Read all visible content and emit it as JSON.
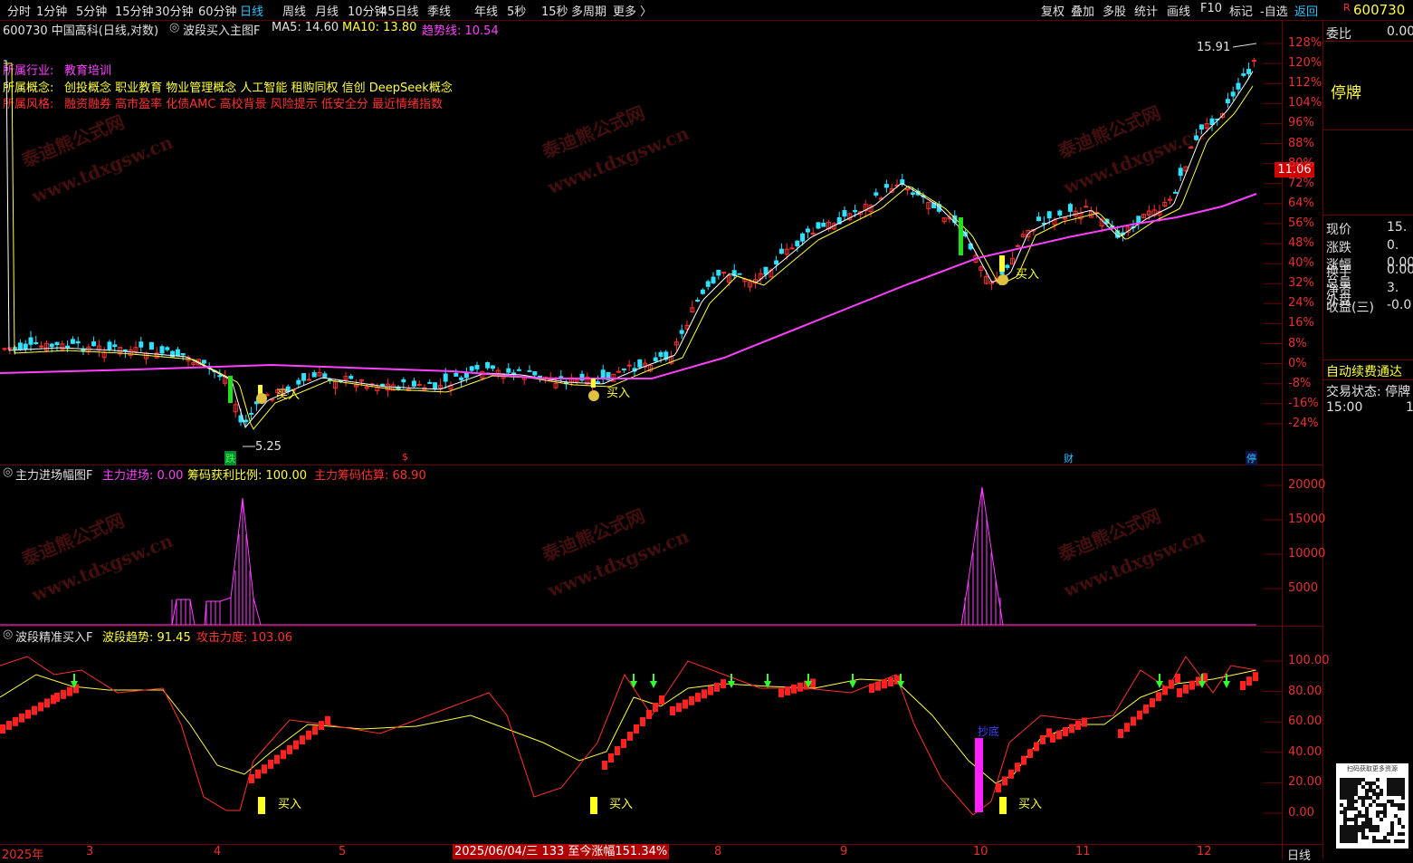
{
  "toolbar": {
    "timeframes": [
      "分时",
      "1分钟",
      "5分钟",
      "15分钟",
      "30分钟",
      "60分钟",
      "日线",
      "周线",
      "月线",
      "10分钟",
      "45日线",
      "季线",
      "年线",
      "5秒",
      "15秒",
      "多周期",
      "更多 〉"
    ],
    "active_timeframe": "日线",
    "right_buttons": [
      "复权",
      "叠加",
      "多股",
      "统计",
      "画线",
      "F10",
      "标记",
      "-自选",
      "返回"
    ],
    "right_panel_code_prefix": "R",
    "right_panel_code": "600730"
  },
  "main_panel": {
    "title": "600730 中国高科(日线,对数)",
    "indicator": "波段买入主图F",
    "ma5": "MA5: 14.60",
    "ma10": "MA10: 13.80",
    "trend": "趋势线: 10.54",
    "industry_label": "所属行业:",
    "industry": "教育培训",
    "concept_label": "所属概念:",
    "concepts": "创投概念 职业教育 物业管理概念 人工智能 租购同权 信创 DeepSeek概念",
    "style_label": "所属风格:",
    "styles": "融资融券 高市盈率 化债AMC 高校背景 风险提示 低安全分 最近情绪指数",
    "high_price": "15.91",
    "low_price": "5.25",
    "current_price_tag": "11.06",
    "buy_label": "买入",
    "markers": [
      "跌",
      "$",
      "财",
      "停"
    ],
    "pct_ticks": [
      "128%",
      "120%",
      "112%",
      "104%",
      "96%",
      "88%",
      "80%",
      "72%",
      "64%",
      "56%",
      "48%",
      "40%",
      "32%",
      "24%",
      "16%",
      "8%",
      "0%",
      "-8%",
      "-16%",
      "-24%"
    ]
  },
  "mid_panel": {
    "indicator": "主力进场幅图F",
    "f1": "主力进场: 0.00",
    "f2": "筹码获利比例: 100.00",
    "f3": "主力筹码估算: 68.90",
    "ticks": [
      "20000",
      "15000",
      "10000",
      "5000"
    ]
  },
  "bot_panel": {
    "indicator": "波段精准买入F",
    "f1": "波段趋势: 91.45",
    "f2": "攻击力度: 103.06",
    "chaodi": "抄底",
    "ticks": [
      "100.00",
      "80.00",
      "60.00",
      "40.00",
      "20.00",
      "0.00"
    ]
  },
  "xaxis": {
    "year": "2025年",
    "months": [
      "3",
      "4",
      "5",
      "6",
      "7",
      "8",
      "9",
      "10",
      "11",
      "12"
    ],
    "cursor_info": "2025/06/04/三 133 至今涨幅151.34%",
    "period": "日线"
  },
  "right_panel": {
    "weibi_label": "委比",
    "weibi_value": "0.00",
    "status": "停牌",
    "rows": [
      {
        "label": "现价",
        "value": "15."
      },
      {
        "label": "涨跌",
        "value": "0."
      },
      {
        "label": "涨幅",
        "value": "0.00"
      },
      {
        "label": "总量",
        "value": ""
      },
      {
        "label": "外盘",
        "value": ""
      },
      {
        "label": "换手",
        "value": "0.00"
      },
      {
        "label": "净资",
        "value": "3."
      },
      {
        "label": "收益(三)",
        "value": "-0.0"
      }
    ],
    "auto_renew": "自动续费通达",
    "trade_status": "交易状态: 停牌",
    "time": "15:00",
    "time_value": "1",
    "qr_caption": "扫码获取更多资源"
  },
  "watermark": {
    "cn": "泰迪熊公式网",
    "en": "www.tdxgsw.cn"
  },
  "colors": {
    "up": "#ff3030",
    "down": "#30e0ff",
    "ma5": "#ffffff",
    "ma10": "#ffff40",
    "trend": "#ff40ff",
    "axis": "#e83030",
    "bg": "#000000"
  }
}
